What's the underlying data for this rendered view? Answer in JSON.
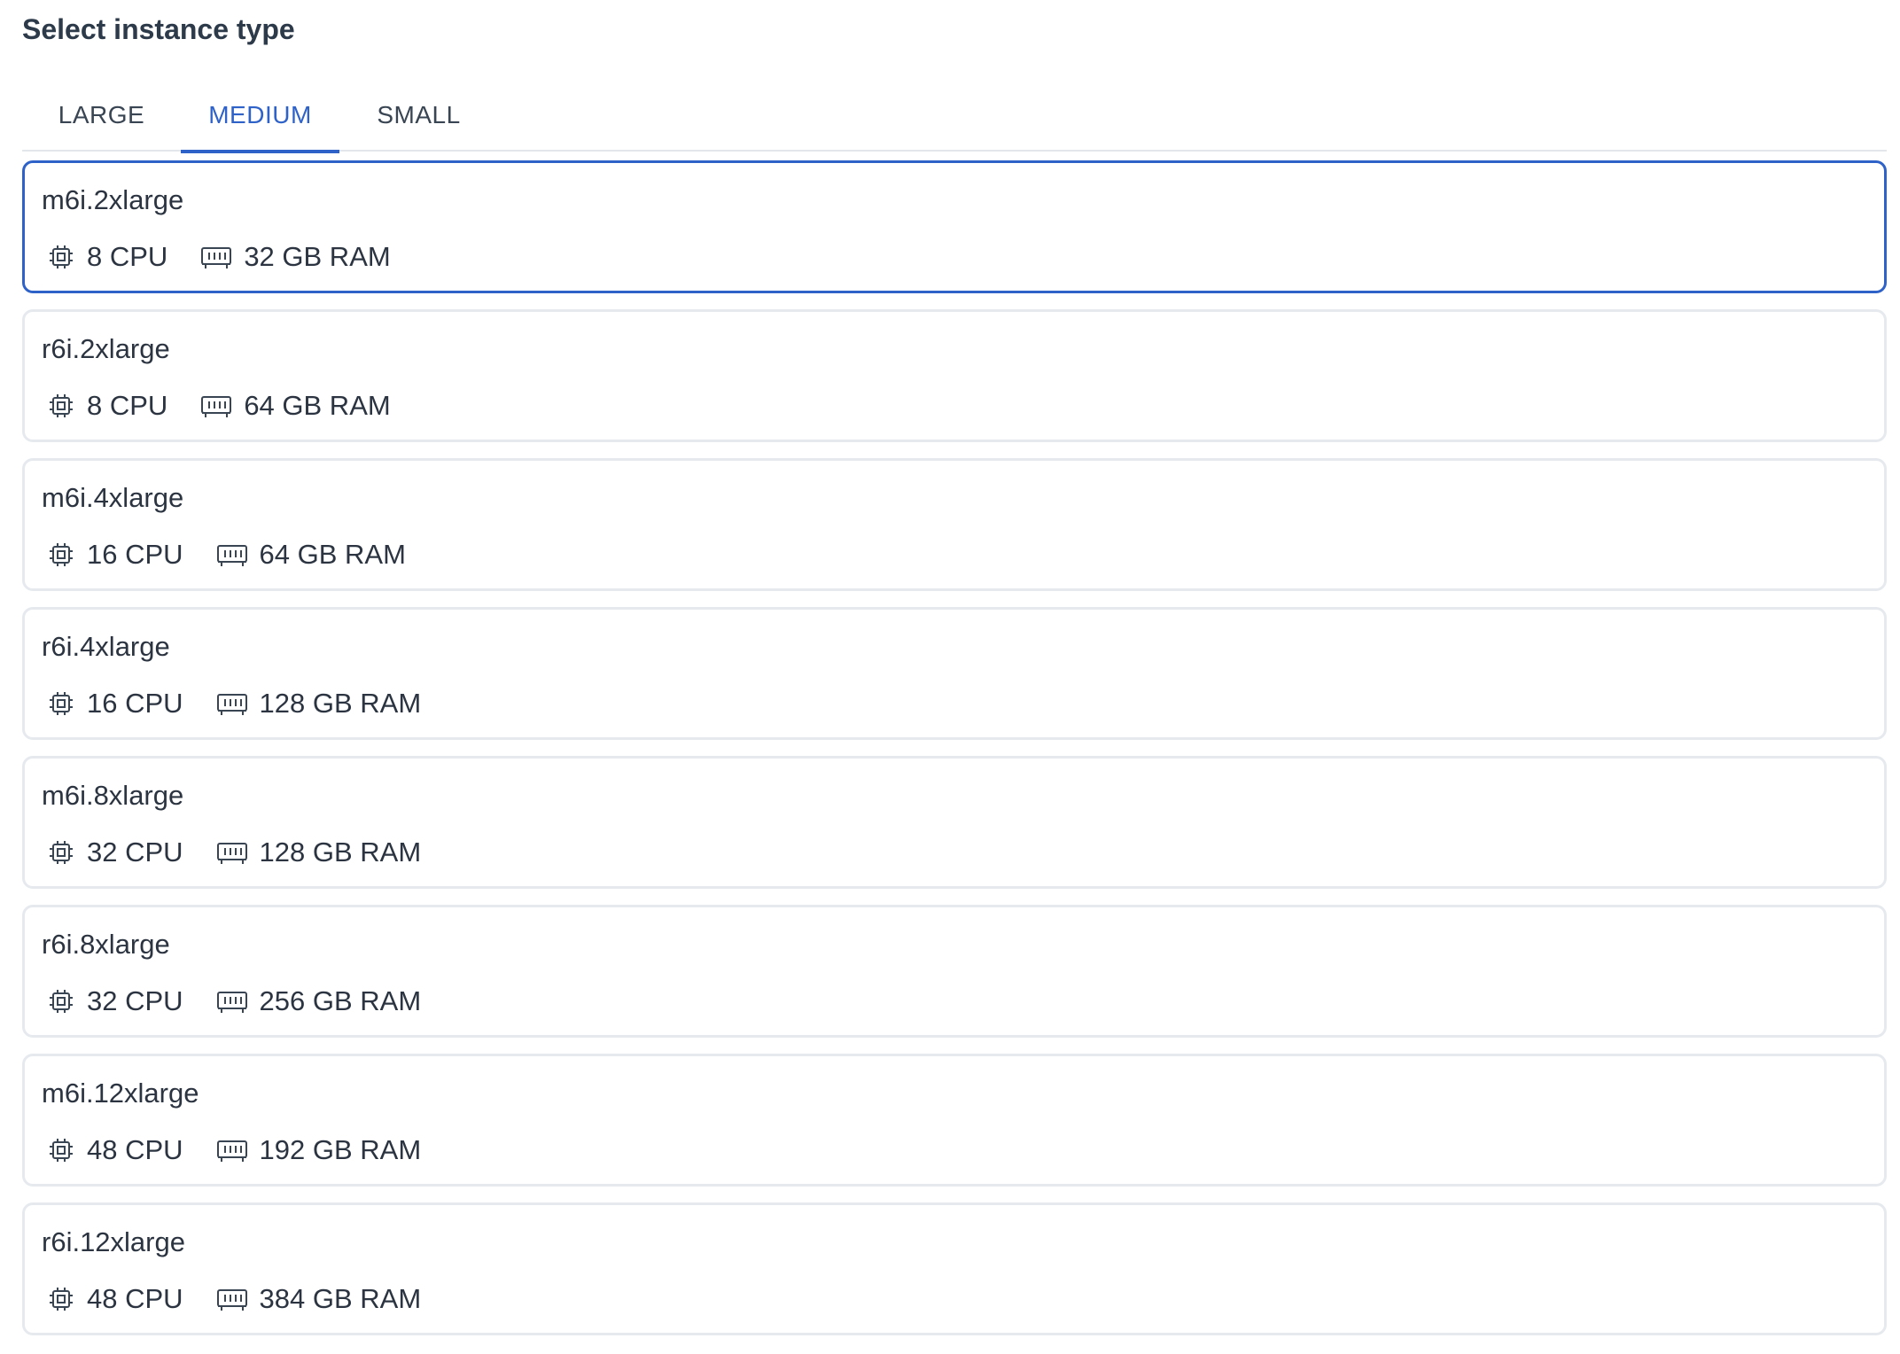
{
  "header": {
    "title": "Select instance type"
  },
  "tabs": [
    {
      "label": "LARGE",
      "selected": false
    },
    {
      "label": "MEDIUM",
      "selected": true
    },
    {
      "label": "SMALL",
      "selected": false
    }
  ],
  "icons": {
    "cpu": "cpu-chip-icon",
    "ram": "memory-module-icon"
  },
  "colors": {
    "accent": "#2f62c8",
    "border": "#e6e9ee",
    "text": "#2b3440"
  },
  "instances": [
    {
      "name": "m6i.2xlarge",
      "cpu": "8 CPU",
      "ram": "32 GB RAM",
      "selected": true
    },
    {
      "name": "r6i.2xlarge",
      "cpu": "8 CPU",
      "ram": "64 GB RAM",
      "selected": false
    },
    {
      "name": "m6i.4xlarge",
      "cpu": "16 CPU",
      "ram": "64 GB RAM",
      "selected": false
    },
    {
      "name": "r6i.4xlarge",
      "cpu": "16 CPU",
      "ram": "128 GB RAM",
      "selected": false
    },
    {
      "name": "m6i.8xlarge",
      "cpu": "32 CPU",
      "ram": "128 GB RAM",
      "selected": false
    },
    {
      "name": "r6i.8xlarge",
      "cpu": "32 CPU",
      "ram": "256 GB RAM",
      "selected": false
    },
    {
      "name": "m6i.12xlarge",
      "cpu": "48 CPU",
      "ram": "192 GB RAM",
      "selected": false
    },
    {
      "name": "r6i.12xlarge",
      "cpu": "48 CPU",
      "ram": "384 GB RAM",
      "selected": false
    }
  ]
}
